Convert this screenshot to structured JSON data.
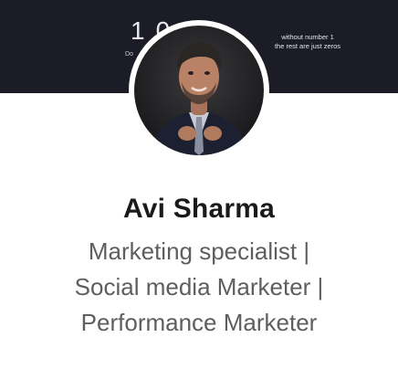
{
  "banner": {
    "number": "10",
    "small_text": "Do",
    "tagline_line1": "without number 1",
    "tagline_line2": "the rest are just zeros",
    "background": "#1b1c25"
  },
  "profile": {
    "name": "Avi Sharma",
    "headline_line1": "Marketing specialist |",
    "headline_line2": "Social media Marketer |",
    "headline_line3": "Performance Marketer"
  },
  "colors": {
    "name": "#1a1a1a",
    "headline": "#5e5e5e"
  }
}
